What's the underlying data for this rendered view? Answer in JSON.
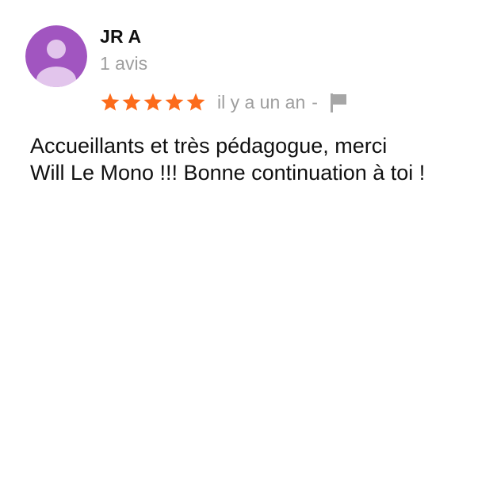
{
  "review": {
    "author_name": "JR A",
    "review_count": "1 avis",
    "rating": 5,
    "rating_max": 5,
    "date": "il y a un an",
    "separator": "-",
    "text_line1": "Accueillants et très pédagogue, merci",
    "text_line2": "Will Le Mono !!! Bonne continuation à toi !"
  },
  "icons": {
    "avatar": "default-user-avatar-icon",
    "star": "star-icon",
    "flag": "flag-icon"
  },
  "colors": {
    "avatar_background": "#a155c0",
    "avatar_figure": "#e2c5ec",
    "star": "#fc6b1b",
    "secondary_text": "#9e9e9e",
    "flag": "#a6a6a6"
  }
}
